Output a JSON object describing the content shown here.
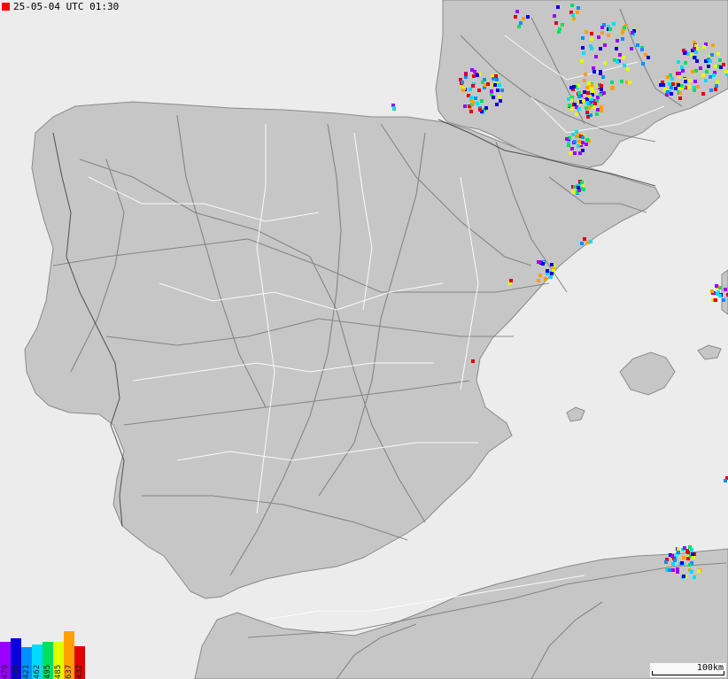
{
  "timestamp": {
    "text": "25-05-04 UTC 01:30",
    "color": "#ff0000"
  },
  "scale_label": "100km",
  "colors": {
    "sea": "#ececec",
    "land": "#c6c6c6",
    "land_edge": "#8a8a8a",
    "roads": "#6f6f6f",
    "borders": "#ffffff"
  },
  "legend": [
    {
      "label": "479",
      "color": "#9b00ff",
      "level": 0.52
    },
    {
      "label": "548",
      "color": "#0a00d8",
      "level": 0.58
    },
    {
      "label": "421",
      "color": "#0090ff",
      "level": 0.45
    },
    {
      "label": "462",
      "color": "#00dcff",
      "level": 0.49
    },
    {
      "label": "495",
      "color": "#00e060",
      "level": 0.53
    },
    {
      "label": "485",
      "color": "#e0ff00",
      "level": 0.52
    },
    {
      "label": "637",
      "color": "#ffa000",
      "level": 0.67
    },
    {
      "label": "432",
      "color": "#e00000",
      "level": 0.46
    }
  ]
}
